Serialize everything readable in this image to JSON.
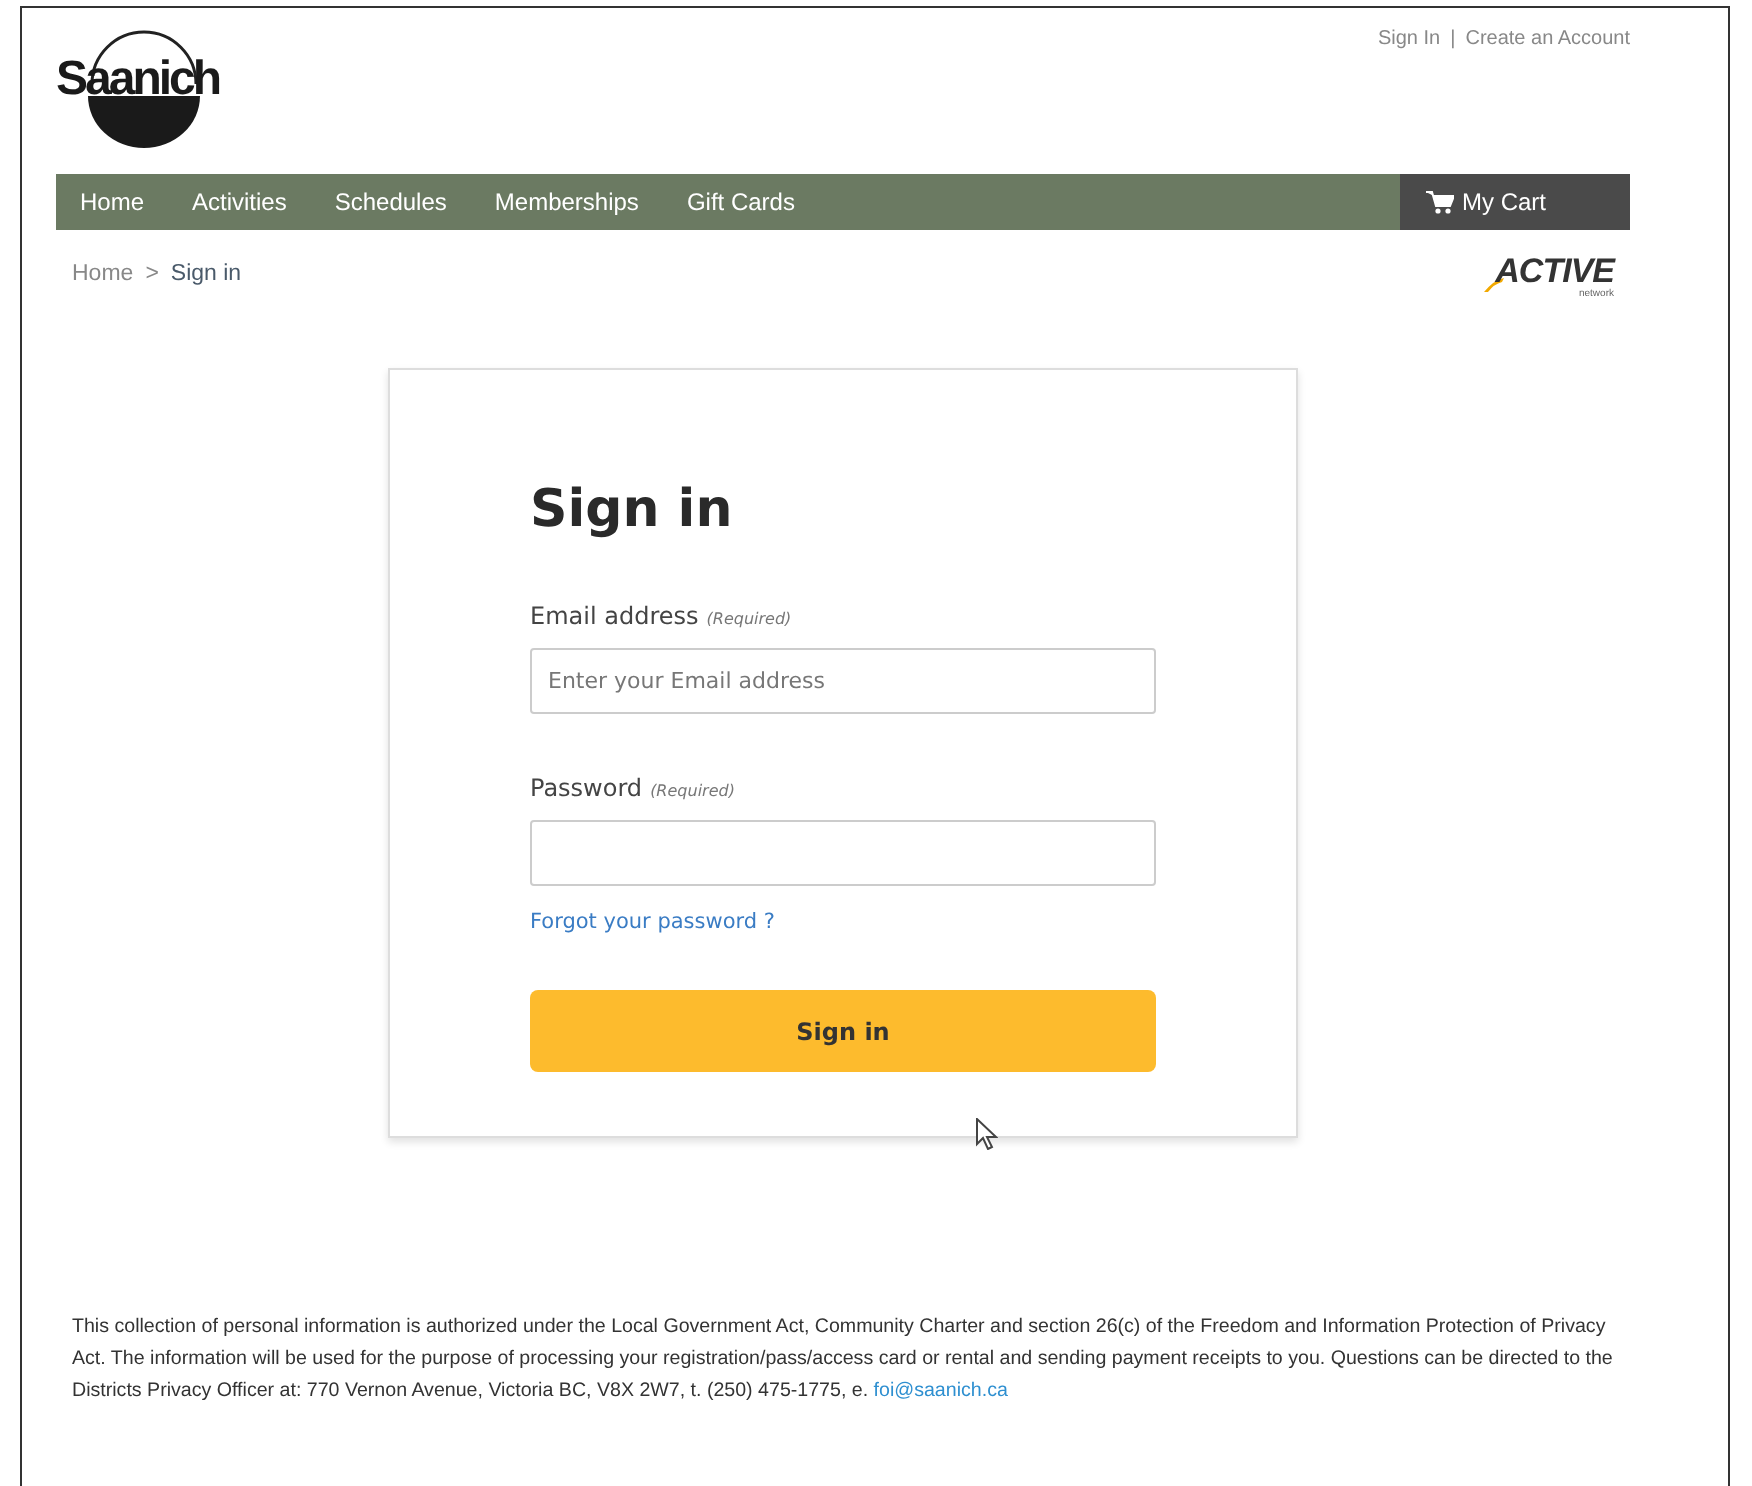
{
  "logo": {
    "text": "Saanich"
  },
  "account_links": {
    "items": [
      "Sign In",
      "Create an Account"
    ],
    "separator": "|"
  },
  "nav": {
    "items": [
      "Home",
      "Activities",
      "Schedules",
      "Memberships",
      "Gift Cards"
    ],
    "cart": "My Cart"
  },
  "breadcrumb": {
    "items": [
      "Home",
      "Sign in"
    ],
    "separator": ">"
  },
  "partner_logo": {
    "text": "ACTIVE",
    "subtext": "network"
  },
  "form": {
    "title": "Sign in",
    "fields": [
      {
        "label": "Email address",
        "note": "(Required)",
        "placeholder": "Enter your Email address"
      },
      {
        "label": "Password",
        "note": "(Required)"
      }
    ],
    "forgot_link": "Forgot your password ?",
    "submit": "Sign in"
  },
  "footer": {
    "text": "This collection of personal information is authorized under the Local Government Act, Community Charter and section 26(c) of the Freedom and Information Protection of Privacy Act. The information will be used for the purpose of processing your registration/pass/access card or rental and sending payment receipts to you. Questions can be directed to the Districts Privacy Officer at: 770 Vernon Avenue, Victoria BC, V8X 2W7, t. (250) 475-1775, e.",
    "email": "foi@saanich.ca"
  }
}
